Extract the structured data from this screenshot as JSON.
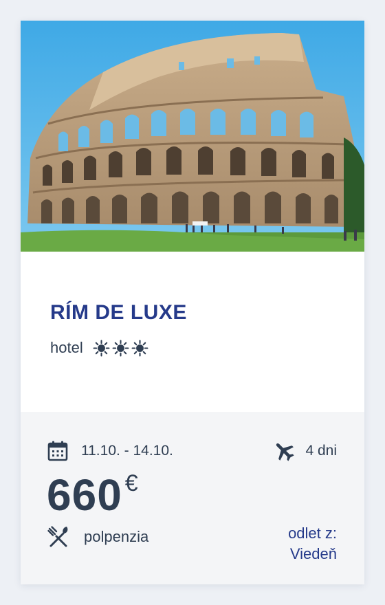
{
  "offer": {
    "title": "RÍM DE LUXE",
    "accommodation_type": "hotel",
    "rating_icons": [
      "sun-icon",
      "sun-icon",
      "sun-icon"
    ],
    "dates": "11.10. - 14.10.",
    "duration": "4 dni",
    "price": "660",
    "currency": "€",
    "board": "polpenzia",
    "departure_label": "odlet z:",
    "departure_city": "Viedeň"
  },
  "colors": {
    "accent": "#253a8a",
    "text": "#2f3e52",
    "panel": "#f4f5f7",
    "background": "#edf0f5"
  },
  "icons": {
    "dates": "calendar-icon",
    "duration": "plane-icon",
    "board": "cutlery-icon"
  }
}
